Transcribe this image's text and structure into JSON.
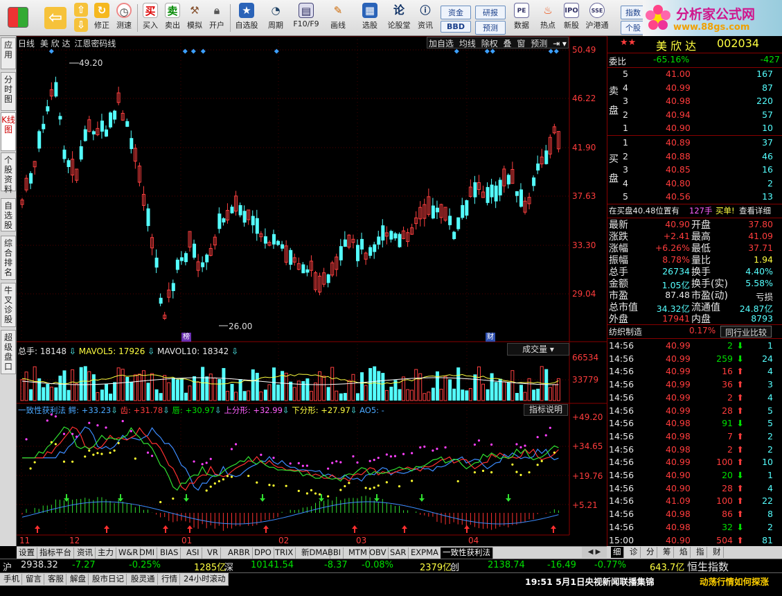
{
  "toolbar": {
    "items": [
      "修正",
      "测速",
      "买入",
      "卖出",
      "模拟",
      "开户",
      "自选股",
      "周期",
      "F10/F9",
      "画线",
      "选股",
      "论股堂",
      "资讯",
      "数据",
      "热点",
      "新股",
      "沪港通"
    ],
    "small": [
      "资金",
      "研报",
      "BBD",
      "预测",
      "指数",
      "个股"
    ],
    "logo_title": "分析家公式网",
    "logo_url": "www.88gs.com"
  },
  "left_tabs": [
    "应用",
    "分时图",
    "K线图",
    "个股资料",
    "自选股",
    "综合排名",
    "牛叉诊股",
    "超级盘口"
  ],
  "chart": {
    "header": {
      "period": "日线",
      "name": "美 欣 达",
      "formula": "江恩密码线"
    },
    "top_buttons": [
      "加自选",
      "均线",
      "除权",
      "叠",
      "窗",
      "预测"
    ],
    "price_axis": [
      "50.49",
      "46.22",
      "41.90",
      "37.63",
      "33.30",
      "29.04"
    ],
    "high_label": "49.20",
    "low_label": "26.00",
    "badge1": "榜",
    "badge2": "财",
    "vol_header": {
      "total": "总手: 18148",
      "ma5": "MAVOL5: 17926",
      "ma10": "MAVOL10: 18342",
      "selector": "成交量"
    },
    "vol_axis": [
      "66534",
      "33779"
    ],
    "ind_header": {
      "title": "一致性获利法",
      "e": "鳄: +33.23",
      "t": "齿: +31.78",
      "c": "唇: +30.97",
      "u": "上分形: +32.99",
      "d": "下分形: +27.97",
      "ao": "AO5: -",
      "btn": "指标说明"
    },
    "ind_axis": [
      "+49.20",
      "+34.65",
      "+19.76",
      "+5.21"
    ],
    "x_labels": [
      "11",
      "12",
      "01",
      "02",
      "03",
      "04"
    ]
  },
  "quote": {
    "title": "美 欣 达",
    "code": "002034",
    "weibi": {
      "label": "委比",
      "pct": "-65.16%",
      "val": "-427"
    },
    "sell": [
      [
        "5",
        "41.00",
        "167"
      ],
      [
        "4",
        "40.99",
        "87"
      ],
      [
        "3",
        "40.98",
        "220"
      ],
      [
        "2",
        "40.94",
        "57"
      ],
      [
        "1",
        "40.90",
        "10"
      ]
    ],
    "buy": [
      [
        "1",
        "40.89",
        "37"
      ],
      [
        "2",
        "40.88",
        "46"
      ],
      [
        "3",
        "40.85",
        "16"
      ],
      [
        "4",
        "40.80",
        "2"
      ],
      [
        "5",
        "40.56",
        "13"
      ]
    ],
    "sell_label": "卖盘",
    "buy_label": "买盘",
    "notice": {
      "t1": "在买盘40.48位置有",
      "t2": "127手",
      "t3": "买单!",
      "t4": "查看详细"
    },
    "stats": [
      [
        "最新",
        "40.90",
        "开盘",
        "37.80"
      ],
      [
        "涨跌",
        "+2.41",
        "最高",
        "41.09"
      ],
      [
        "涨幅",
        "+6.26%",
        "最低",
        "37.71"
      ],
      [
        "振幅",
        "8.78%",
        "量比",
        "1.94"
      ],
      [
        "总手",
        "26734",
        "换手",
        "4.40%"
      ],
      [
        "金额",
        "1.05亿",
        "换手(实)",
        "5.58%"
      ],
      [
        "市盈",
        "87.48",
        "市盈(动)",
        "亏损"
      ],
      [
        "总市值",
        "34.32亿",
        "流通值",
        "24.87亿"
      ],
      [
        "外盘",
        "17941",
        "内盘",
        "8793"
      ]
    ],
    "industry": {
      "name": "纺织制造",
      "pct": "0.17%",
      "btn": "同行业比较"
    },
    "ticks": [
      [
        "14:56",
        "40.99",
        "2",
        "down",
        "1"
      ],
      [
        "14:56",
        "40.99",
        "259",
        "down",
        "24"
      ],
      [
        "14:56",
        "40.99",
        "16",
        "up",
        "4"
      ],
      [
        "14:56",
        "40.99",
        "36",
        "up",
        "3"
      ],
      [
        "14:56",
        "40.99",
        "2",
        "up",
        "4"
      ],
      [
        "14:56",
        "40.99",
        "28",
        "up",
        "5"
      ],
      [
        "14:56",
        "40.98",
        "91",
        "down",
        "5"
      ],
      [
        "14:56",
        "40.98",
        "7",
        "up",
        "2"
      ],
      [
        "14:56",
        "40.98",
        "2",
        "up",
        "2"
      ],
      [
        "14:56",
        "40.99",
        "100",
        "up",
        "10"
      ],
      [
        "14:56",
        "40.90",
        "20",
        "down",
        "1"
      ],
      [
        "14:56",
        "40.90",
        "28",
        "up",
        "4"
      ],
      [
        "14:56",
        "41.09",
        "100",
        "up",
        "22"
      ],
      [
        "14:56",
        "40.98",
        "86",
        "up",
        "8"
      ],
      [
        "14:56",
        "40.98",
        "32",
        "down",
        "2"
      ],
      [
        "15:00",
        "40.90",
        "504",
        "up",
        "81"
      ]
    ]
  },
  "bottom_tabs": [
    "设置",
    "指标平台",
    "资讯",
    "主力",
    "W&R",
    "DMI",
    "BIAS",
    "ASI",
    "VR",
    "ARBR",
    "DPO",
    "TRIX",
    "新DMA",
    "BBI",
    "MTM",
    "OBV",
    "SAR",
    "EXPMA",
    "一致性获利法"
  ],
  "right_tabs": [
    "细",
    "诊",
    "分",
    "筹",
    "焰",
    "指",
    "财"
  ],
  "status": {
    "sh": "沪",
    "sh_idx": "2938.32",
    "sh_chg": "-7.27",
    "sh_pct": "-0.25%",
    "sh_amt": "1285亿",
    "sz": "深",
    "sz_idx": "10141.54",
    "sz_chg": "-8.37",
    "sz_pct": "-0.08%",
    "sz_amt": "2379亿",
    "cy": "创",
    "cy_idx": "2138.74",
    "cy_chg": "-16.49",
    "cy_pct": "-0.77%",
    "cy_amt": "643.7亿",
    "hs": "恒生指数"
  },
  "status2": {
    "items": [
      "手机",
      "留言",
      "客服",
      "解盘",
      "股市日记",
      "股灵通",
      "行情",
      "24小时滚动"
    ],
    "news": "19:51 5月1日央视新闻联播集锦",
    "scroll": "动荡行情如何探涨"
  }
}
